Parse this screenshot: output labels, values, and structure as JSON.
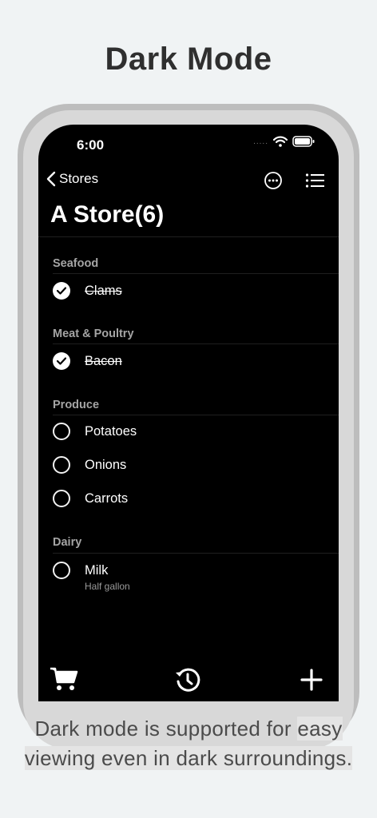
{
  "headline": "Dark Mode",
  "status": {
    "time": "6:00",
    "signal": "....."
  },
  "nav": {
    "back_label": "Stores"
  },
  "list": {
    "title": "A Store(6)",
    "sections": [
      {
        "name": "Seafood",
        "items": [
          {
            "label": "Clams",
            "checked": true
          }
        ]
      },
      {
        "name": "Meat & Poultry",
        "items": [
          {
            "label": "Bacon",
            "checked": true
          }
        ]
      },
      {
        "name": "Produce",
        "items": [
          {
            "label": "Potatoes",
            "checked": false
          },
          {
            "label": "Onions",
            "checked": false
          },
          {
            "label": "Carrots",
            "checked": false
          }
        ]
      },
      {
        "name": "Dairy",
        "items": [
          {
            "label": "Milk",
            "note": "Half gallon",
            "checked": false
          }
        ]
      }
    ]
  },
  "caption": {
    "line1_a": "Dark mode is supported for ",
    "line1_b": "easy",
    "line2": "viewing even in dark surroundings."
  },
  "icons": [
    "back-chevron-icon",
    "more-options-icon",
    "list-view-icon",
    "cart-icon",
    "history-icon",
    "add-icon",
    "wifi-icon",
    "battery-icon",
    "checkmark-icon"
  ],
  "colors": {
    "screen_bg": "#000000",
    "page_bg": "#f0f3f4",
    "section_text": "#a5a5a5"
  }
}
